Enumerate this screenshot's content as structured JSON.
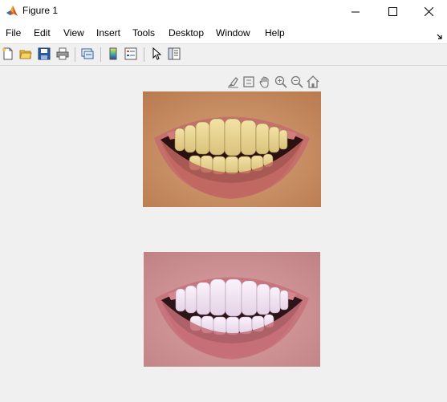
{
  "window": {
    "title": "Figure 1",
    "icon": "matlab-logo-icon",
    "controls": [
      "minimize-icon",
      "maximize-icon",
      "close-icon"
    ]
  },
  "menu": {
    "items": [
      "File",
      "Edit",
      "View",
      "Insert",
      "Tools",
      "Desktop",
      "Window",
      "Help"
    ]
  },
  "toolbar": {
    "buttons": [
      "new-figure-icon",
      "open-file-icon",
      "save-icon",
      "print-icon",
      "link-plot-icon",
      "insert-colorbar-icon",
      "insert-legend-icon",
      "edit-plot-icon",
      "property-inspector-icon"
    ]
  },
  "axes_toolbar": {
    "buttons": [
      "brush-icon",
      "data-tips-icon",
      "pan-icon",
      "zoom-in-icon",
      "zoom-out-icon",
      "restore-view-icon"
    ]
  },
  "images": [
    {
      "name": "original-smile-image",
      "description": "teeth-yellow"
    },
    {
      "name": "whitened-smile-image",
      "description": "teeth-whitened"
    }
  ],
  "colors": {
    "background": "#f0f0f0",
    "titlebar": "#ffffff",
    "accent": "#0072bd"
  }
}
